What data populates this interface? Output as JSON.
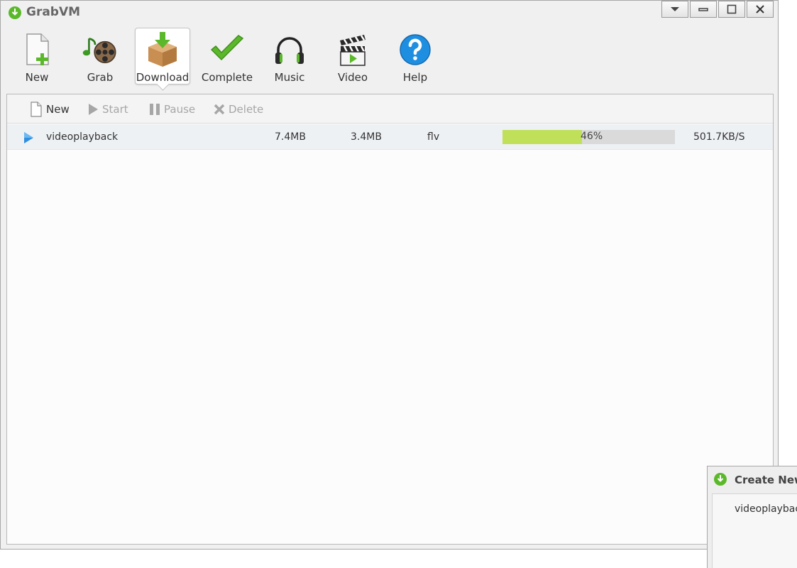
{
  "app": {
    "title": "GrabVM"
  },
  "toolbar": {
    "buttons": [
      {
        "label": "New",
        "icon": "new-file-icon"
      },
      {
        "label": "Grab",
        "icon": "grab-film-reel-icon"
      },
      {
        "label": "Download",
        "icon": "download-box-icon",
        "active": true
      },
      {
        "label": "Complete",
        "icon": "checkmark-icon"
      },
      {
        "label": "Music",
        "icon": "headphones-icon"
      },
      {
        "label": "Video",
        "icon": "clapperboard-icon"
      },
      {
        "label": "Help",
        "icon": "help-icon"
      }
    ]
  },
  "subtoolbar": {
    "new_label": "New",
    "start_label": "Start",
    "pause_label": "Pause",
    "delete_label": "Delete"
  },
  "downloads": [
    {
      "name": "videoplayback",
      "total_size": "7.4MB",
      "downloaded": "3.4MB",
      "format": "flv",
      "progress_percent": 46,
      "progress_text": "46%",
      "speed": "501.7KB/S"
    }
  ],
  "dialog": {
    "title": "Create New",
    "filename": "videoplaybac"
  },
  "colors": {
    "progress_fill": "#c0e05a",
    "progress_track": "#dadada",
    "accent_green": "#6cbf2a",
    "accent_blue": "#1e8fe0"
  }
}
